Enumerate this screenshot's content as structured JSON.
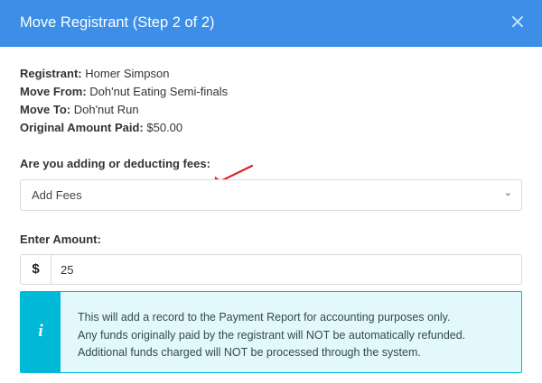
{
  "modal": {
    "title": "Move Registrant (Step 2 of 2)",
    "close_symbol": "×"
  },
  "info": {
    "registrant_label": "Registrant:",
    "registrant_value": "Homer Simpson",
    "move_from_label": "Move From:",
    "move_from_value": "Doh'nut Eating Semi-finals",
    "move_to_label": "Move To:",
    "move_to_value": "Doh'nut Run",
    "original_amount_label": "Original Amount Paid:",
    "original_amount_value": "$50.00"
  },
  "fees": {
    "label": "Are you adding or deducting fees:",
    "selected": "Add Fees",
    "chevron_icon": "chevron-down-icon"
  },
  "amount": {
    "label": "Enter Amount:",
    "prefix": "$",
    "value": "25"
  },
  "callout": {
    "icon": "info-icon",
    "icon_glyph": "i",
    "lines": [
      "This will add a record to the Payment Report for accounting purposes only.",
      "Any funds originally paid by the registrant will NOT be automatically refunded.",
      "Additional funds charged will NOT be processed through the system."
    ]
  },
  "colors": {
    "header_bg": "#3c8ee6",
    "callout_accent": "#00b9d6",
    "callout_bg": "#e3f8fb",
    "annotation_arrow": "#e02020"
  }
}
